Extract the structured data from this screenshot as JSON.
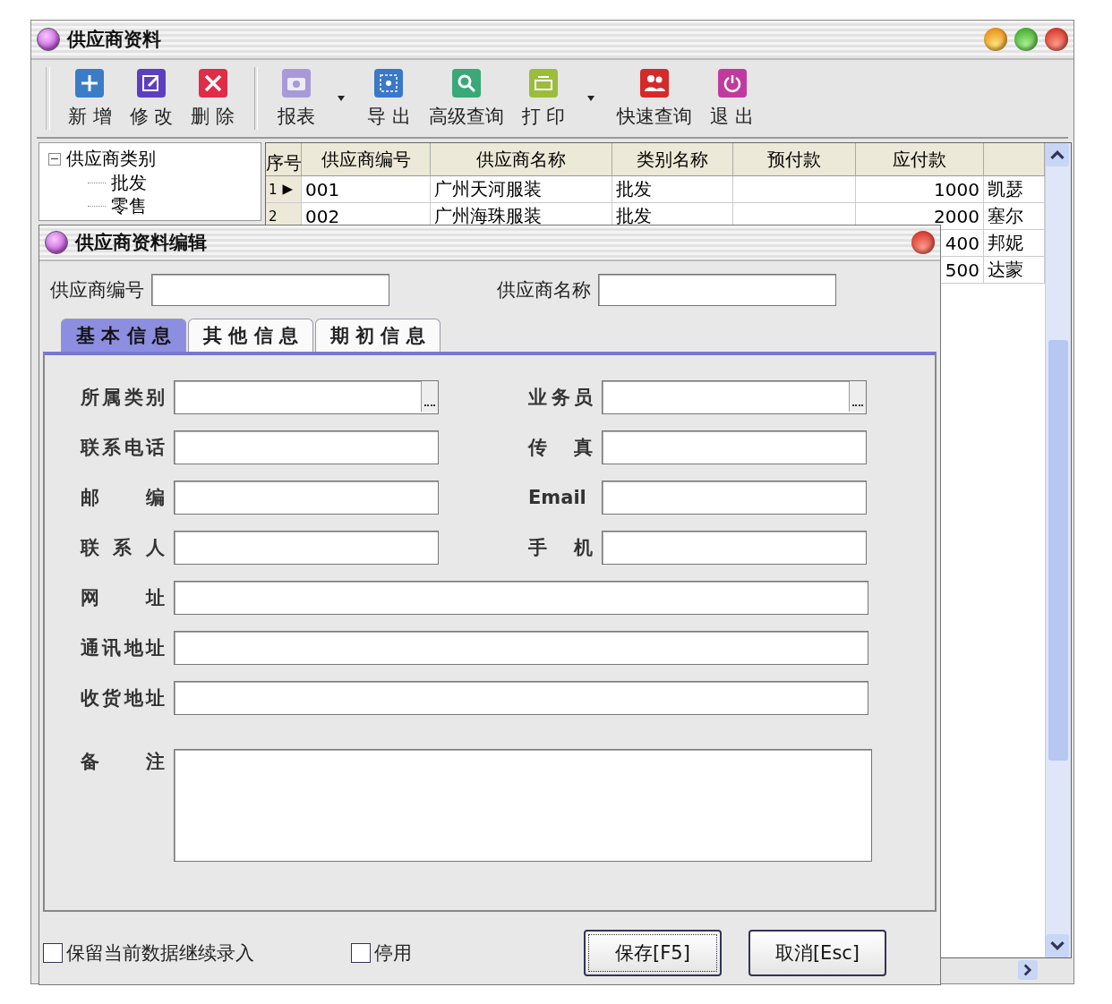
{
  "window": {
    "title": "供应商资料"
  },
  "toolbar": [
    {
      "kind": "button",
      "label": "新 增"
    },
    {
      "kind": "button",
      "label": "修 改"
    },
    {
      "kind": "button",
      "label": "删 除"
    },
    {
      "kind": "separator"
    },
    {
      "kind": "button",
      "label": "报表"
    },
    {
      "kind": "dropdown"
    },
    {
      "kind": "button",
      "label": "导 出"
    },
    {
      "kind": "button",
      "label": "高级查询"
    },
    {
      "kind": "button",
      "label": "打 印"
    },
    {
      "kind": "dropdown"
    },
    {
      "kind": "button",
      "label": "快速查询"
    },
    {
      "kind": "button",
      "label": "退 出"
    }
  ],
  "tree": {
    "label": "供应商类别",
    "expanded": true,
    "children": [
      {
        "label": "批发"
      },
      {
        "label": "零售"
      }
    ]
  },
  "table": {
    "columns": [
      "序号",
      "供应商编号",
      "供应商名称",
      "类别名称",
      "预付款",
      "应付款"
    ],
    "rows": [
      {
        "indicator": "▶",
        "cells": [
          "1",
          "001",
          "广州天河服装",
          "批发",
          "",
          "1000",
          "凯瑟"
        ]
      },
      {
        "cells": [
          "2",
          "002",
          "广州海珠服装",
          "批发",
          "",
          "2000",
          "塞尔"
        ]
      },
      {
        "cells": [
          "",
          "",
          "",
          "",
          "",
          "400",
          "邦妮"
        ]
      },
      {
        "cells": [
          "",
          "",
          "",
          "",
          "",
          "500",
          "达蒙"
        ]
      }
    ]
  },
  "dialog": {
    "title": "供应商资料编辑",
    "header_fields": [
      {
        "label": "供应商编号"
      },
      {
        "label": "供应商名称"
      }
    ],
    "tabs": [
      {
        "label": "基 本 信 息",
        "selected": true
      },
      {
        "label": "其 他 信 息",
        "selected": false
      },
      {
        "label": "期 初 信 息",
        "selected": false
      }
    ],
    "rows": [
      {
        "kind": "pair",
        "fields": [
          {
            "label": "所属类别",
            "kind": "browse"
          },
          {
            "label": "业务员",
            "kind": "browse"
          }
        ]
      },
      {
        "kind": "pair",
        "fields": [
          {
            "label": "联系电话",
            "kind": "text"
          },
          {
            "label": "传 真",
            "kind": "text"
          }
        ]
      },
      {
        "kind": "pair",
        "fields": [
          {
            "label": "邮 编",
            "kind": "text"
          },
          {
            "label": "Email",
            "kind": "text"
          }
        ]
      },
      {
        "kind": "pair",
        "fields": [
          {
            "label": "联 系 人",
            "kind": "text"
          },
          {
            "label": "手 机",
            "kind": "text"
          }
        ]
      },
      {
        "kind": "wide",
        "label": "网 址"
      },
      {
        "kind": "wide",
        "label": "通讯地址"
      },
      {
        "kind": "wide",
        "label": "收货地址"
      },
      {
        "kind": "memo",
        "label": "备 注"
      }
    ],
    "checkboxes": [
      {
        "label": "保留当前数据继续录入",
        "checked": false
      },
      {
        "label": "停用",
        "checked": false
      }
    ],
    "buttons": [
      {
        "label": "保存[F5]",
        "focused": true
      },
      {
        "label": "取消[Esc]",
        "focused": false
      }
    ]
  }
}
